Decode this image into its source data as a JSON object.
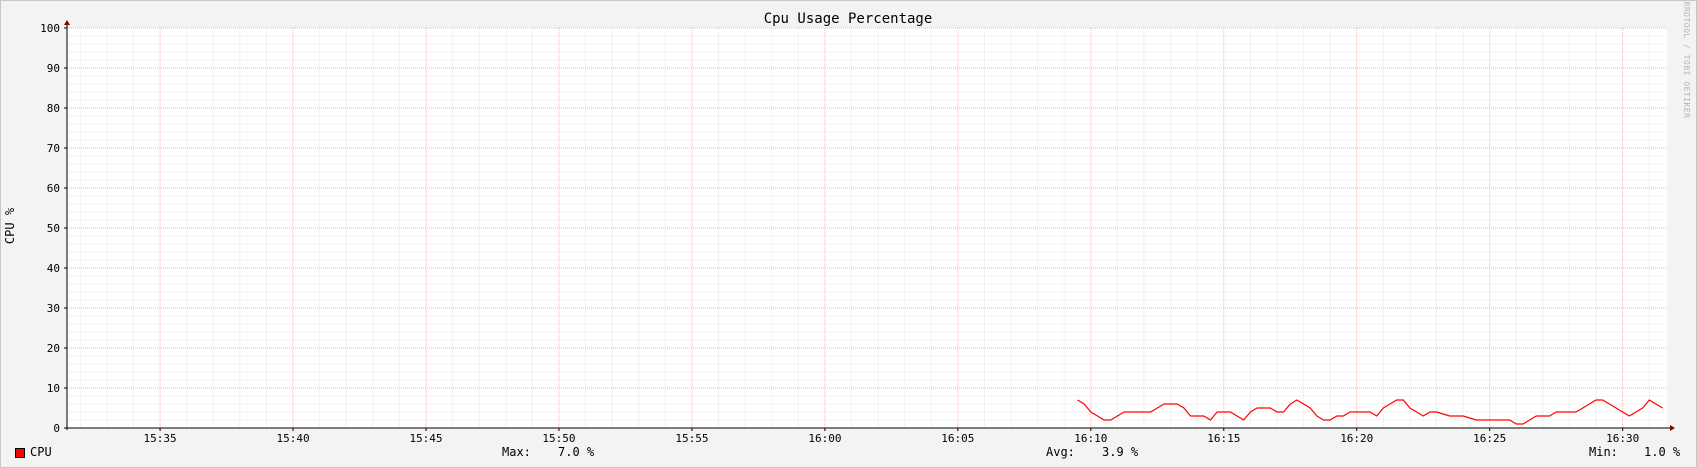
{
  "chart_data": {
    "type": "line",
    "title": "Cpu Usage Percentage",
    "ylabel": "CPU %",
    "watermark": "RRDTOOL / TOBI OETIKER",
    "ylim": [
      0,
      100
    ],
    "yticks": [
      0,
      10,
      20,
      30,
      40,
      50,
      60,
      70,
      80,
      90,
      100
    ],
    "xlim": [
      "15:31:30",
      "16:31:40"
    ],
    "xticks": [
      "15:35",
      "15:40",
      "15:45",
      "15:50",
      "15:55",
      "16:00",
      "16:05",
      "16:10",
      "16:15",
      "16:20",
      "16:25",
      "16:30"
    ],
    "grid": true,
    "series": [
      {
        "name": "CPU",
        "color": "#ff0000",
        "x": [
          "16:09:30",
          "16:09:45",
          "16:10:00",
          "16:10:15",
          "16:10:30",
          "16:10:45",
          "16:11:00",
          "16:11:15",
          "16:11:30",
          "16:11:45",
          "16:12:00",
          "16:12:15",
          "16:12:30",
          "16:12:45",
          "16:13:00",
          "16:13:15",
          "16:13:30",
          "16:13:45",
          "16:14:00",
          "16:14:15",
          "16:14:30",
          "16:14:45",
          "16:15:00",
          "16:15:15",
          "16:15:30",
          "16:15:45",
          "16:16:00",
          "16:16:15",
          "16:16:30",
          "16:16:45",
          "16:17:00",
          "16:17:15",
          "16:17:30",
          "16:17:45",
          "16:18:00",
          "16:18:15",
          "16:18:30",
          "16:18:45",
          "16:19:00",
          "16:19:15",
          "16:19:30",
          "16:19:45",
          "16:20:00",
          "16:20:15",
          "16:20:30",
          "16:20:45",
          "16:21:00",
          "16:21:15",
          "16:21:30",
          "16:21:45",
          "16:22:00",
          "16:22:15",
          "16:22:30",
          "16:22:45",
          "16:23:00",
          "16:23:30",
          "16:24:00",
          "16:24:30",
          "16:25:00",
          "16:25:15",
          "16:25:30",
          "16:25:45",
          "16:26:00",
          "16:26:15",
          "16:26:30",
          "16:26:45",
          "16:27:00",
          "16:27:15",
          "16:27:30",
          "16:27:45",
          "16:28:00",
          "16:28:15",
          "16:28:30",
          "16:28:45",
          "16:29:00",
          "16:29:15",
          "16:29:30",
          "16:29:45",
          "16:30:00",
          "16:30:15",
          "16:30:30",
          "16:30:45",
          "16:31:00",
          "16:31:15",
          "16:31:30"
        ],
        "values": [
          7,
          6,
          4,
          3,
          2,
          2,
          3,
          4,
          4,
          4,
          4,
          4,
          5,
          6,
          6,
          6,
          5,
          3,
          3,
          3,
          2,
          4,
          4,
          4,
          3,
          2,
          4,
          5,
          5,
          5,
          4,
          4,
          6,
          7,
          6,
          5,
          3,
          2,
          2,
          3,
          3,
          4,
          4,
          4,
          4,
          3,
          5,
          6,
          7,
          7,
          5,
          4,
          3,
          4,
          4,
          3,
          3,
          2,
          2,
          2,
          2,
          2,
          1,
          1,
          2,
          3,
          3,
          3,
          4,
          4,
          4,
          4,
          5,
          6,
          7,
          7,
          6,
          5,
          4,
          3,
          4,
          5,
          7,
          6,
          5
        ]
      }
    ],
    "legend": {
      "label": "CPU",
      "max_label": "Max:",
      "max_value": "7.0 %",
      "avg_label": "Avg:",
      "avg_value": "3.9 %",
      "min_label": "Min:",
      "min_value": "1.0 %"
    }
  }
}
